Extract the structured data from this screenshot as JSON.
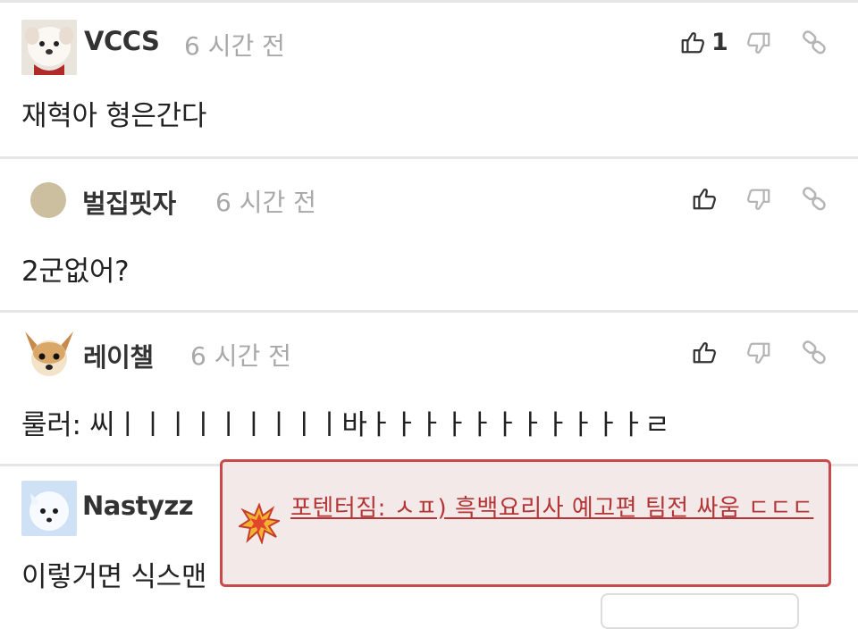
{
  "comments": [
    {
      "username": "VCCS",
      "time": "6 시간 전",
      "text": "재혁아 형은간다",
      "likes": "1"
    },
    {
      "username": "벌집핏자",
      "time": "6 시간 전",
      "text": "2군없어?",
      "likes": ""
    },
    {
      "username": "레이챌",
      "time": "6 시간 전",
      "text": "룰러: 씨ㅣㅣㅣㅣㅣㅣㅣㅣㅣ바ㅏㅏㅏㅏㅏㅏㅏㅏㅏㅏㅏㄹ",
      "likes": ""
    },
    {
      "username": "Nastyzz",
      "time": "",
      "text": "이렇거면 식스맨",
      "likes": ""
    }
  ],
  "popup": {
    "link_text": "포텐터짐: ㅅㅍ) 흑백요리사 예고편 팀전 싸움 ㄷㄷㄷ"
  },
  "colors": {
    "popup_border": "#c94a4a",
    "popup_bg": "#f3e9e9",
    "popup_link": "#b43535",
    "timestamp": "#a8a8a8"
  },
  "icons": [
    "thumbs-up-icon",
    "thumbs-down-icon",
    "link-icon",
    "explosion-icon"
  ]
}
